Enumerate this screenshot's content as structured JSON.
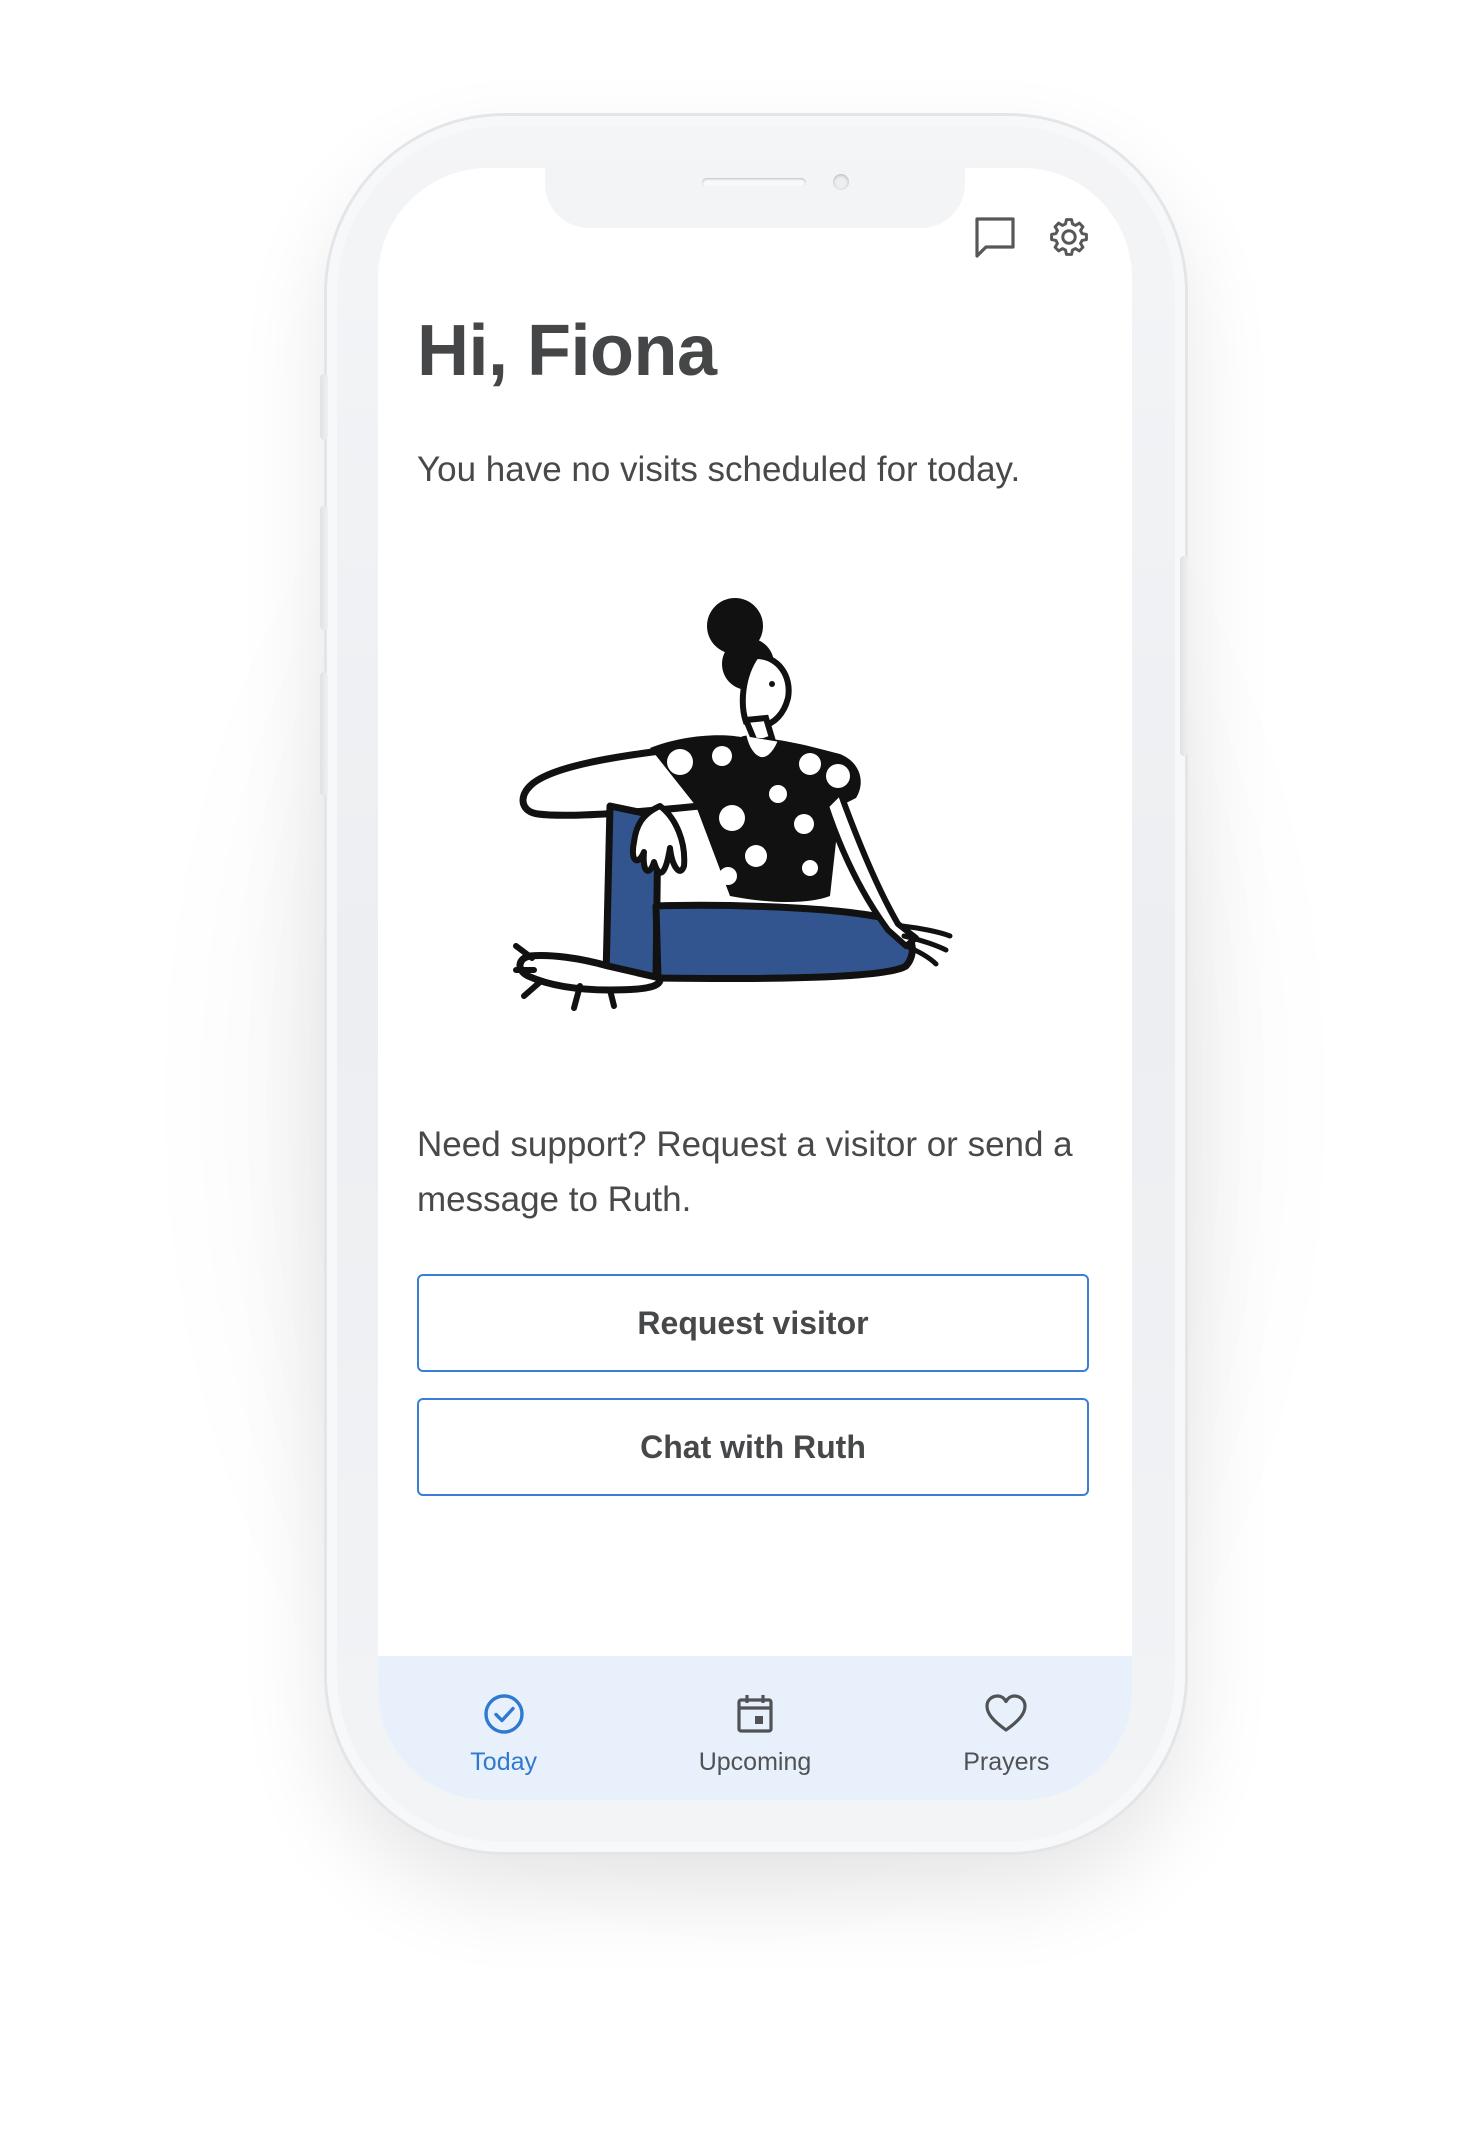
{
  "header": {
    "message_icon": "chat-bubble-icon",
    "settings_icon": "gear-icon"
  },
  "main": {
    "greeting": "Hi, Fiona",
    "status_text": "You have no visits scheduled for today.",
    "illustration": "woman-sitting-illustration",
    "support_text": "Need support? Request a visitor or send a message to Ruth.",
    "request_button_label": "Request visitor",
    "chat_button_label": "Chat with Ruth"
  },
  "tabs": [
    {
      "label": "Today",
      "icon": "check-circle-icon",
      "active": true
    },
    {
      "label": "Upcoming",
      "icon": "calendar-icon",
      "active": false
    },
    {
      "label": "Prayers",
      "icon": "heart-icon",
      "active": false
    }
  ],
  "colors": {
    "accent": "#2e7ad1",
    "button_border": "#3a7fd5",
    "tabbar_background": "#e8f0fc",
    "text": "#48494b",
    "illustration_blue": "#33558f"
  }
}
